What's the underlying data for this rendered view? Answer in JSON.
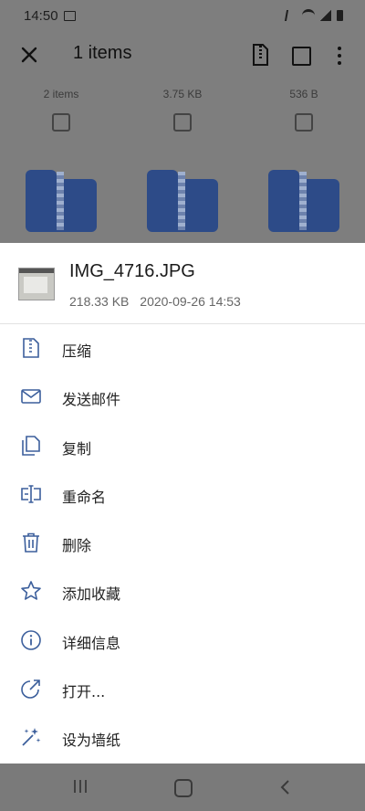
{
  "status_bar": {
    "time": "14:50"
  },
  "app_bar": {
    "title": "1 items"
  },
  "grid": {
    "items": [
      {
        "caption": "2 items"
      },
      {
        "caption": "3.75 KB"
      },
      {
        "caption": "536 B"
      }
    ]
  },
  "sheet": {
    "file_name": "IMG_4716.JPG",
    "file_size": "218.33 KB",
    "file_date": "2020-09-26 14:53",
    "actions": [
      {
        "label": "压缩",
        "icon": "compress-icon"
      },
      {
        "label": "发送邮件",
        "icon": "mail-icon"
      },
      {
        "label": "复制",
        "icon": "copy-icon"
      },
      {
        "label": "重命名",
        "icon": "rename-icon"
      },
      {
        "label": "删除",
        "icon": "delete-icon"
      },
      {
        "label": "添加收藏",
        "icon": "star-icon"
      },
      {
        "label": "详细信息",
        "icon": "info-icon"
      },
      {
        "label": "打开...",
        "icon": "open-with-icon"
      },
      {
        "label": "设为墙纸",
        "icon": "wallpaper-icon"
      }
    ]
  },
  "colors": {
    "scrim": "#7e7e7e",
    "accent": "#2d4b88",
    "icon_stroke": "#3c5f9c"
  }
}
